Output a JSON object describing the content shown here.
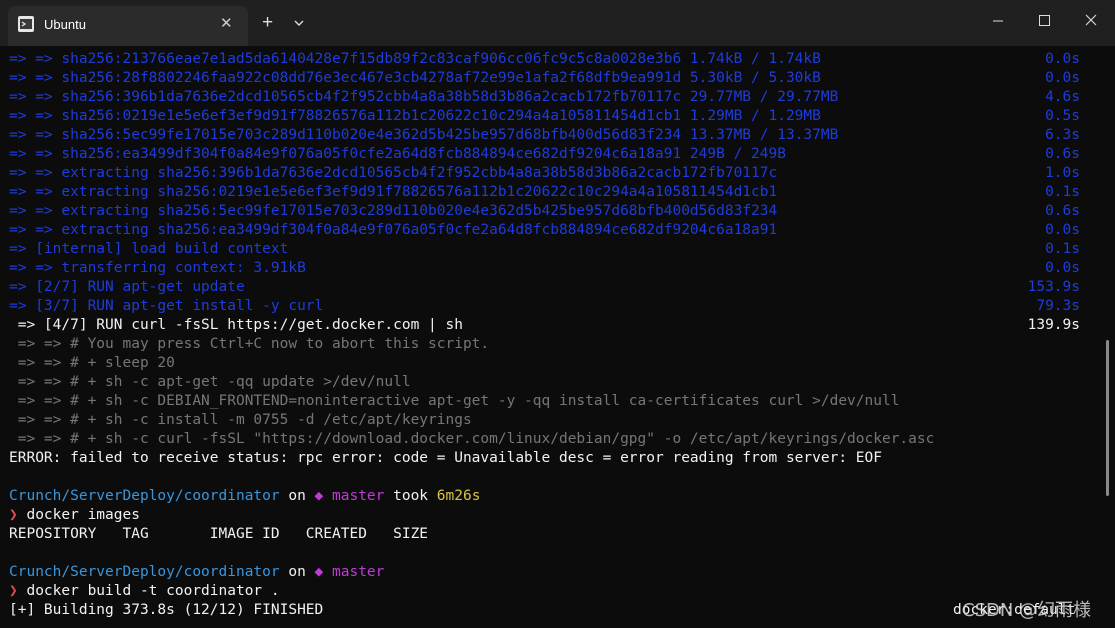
{
  "window": {
    "tab_title": "Ubuntu",
    "close_tab_glyph": "✕",
    "new_tab_glyph": "+",
    "icons": [
      "ubuntu-tab-icon",
      "close-icon",
      "plus-icon",
      "chevron-down-icon",
      "minimize-icon",
      "maximize-icon",
      "close-window-icon"
    ]
  },
  "terminal": {
    "build_steps": [
      {
        "text": "=> => sha256:213766eae7e1ad5da6140428e7f15db89f2c83caf906cc06fc9c5c8a0028e3b6 1.74kB / 1.74kB",
        "time": "0.0s"
      },
      {
        "text": "=> => sha256:28f8802246faa922c08dd76e3ec467e3cb4278af72e99e1afa2f68dfb9ea991d 5.30kB / 5.30kB",
        "time": "0.0s"
      },
      {
        "text": "=> => sha256:396b1da7636e2dcd10565cb4f2f952cbb4a8a38b58d3b86a2cacb172fb70117c 29.77MB / 29.77MB",
        "time": "4.6s"
      },
      {
        "text": "=> => sha256:0219e1e5e6ef3ef9d91f78826576a112b1c20622c10c294a4a105811454d1cb1 1.29MB / 1.29MB",
        "time": "0.5s"
      },
      {
        "text": "=> => sha256:5ec99fe17015e703c289d110b020e4e362d5b425be957d68bfb400d56d83f234 13.37MB / 13.37MB",
        "time": "6.3s"
      },
      {
        "text": "=> => sha256:ea3499df304f0a84e9f076a05f0cfe2a64d8fcb884894ce682df9204c6a18a91 249B / 249B",
        "time": "0.6s"
      },
      {
        "text": "=> => extracting sha256:396b1da7636e2dcd10565cb4f2f952cbb4a8a38b58d3b86a2cacb172fb70117c",
        "time": "1.0s"
      },
      {
        "text": "=> => extracting sha256:0219e1e5e6ef3ef9d91f78826576a112b1c20622c10c294a4a105811454d1cb1",
        "time": "0.1s"
      },
      {
        "text": "=> => extracting sha256:5ec99fe17015e703c289d110b020e4e362d5b425be957d68bfb400d56d83f234",
        "time": "0.6s"
      },
      {
        "text": "=> => extracting sha256:ea3499df304f0a84e9f076a05f0cfe2a64d8fcb884894ce682df9204c6a18a91",
        "time": "0.0s"
      },
      {
        "text": "=> [internal] load build context",
        "time": "0.1s"
      },
      {
        "text": "=> => transferring context: 3.91kB",
        "time": "0.0s"
      },
      {
        "text": "=> [2/7] RUN apt-get update",
        "time": "153.9s"
      },
      {
        "text": "=> [3/7] RUN apt-get install -y curl",
        "time": "79.3s"
      }
    ],
    "active_step": {
      "text": " => [4/7] RUN curl -fsSL https://get.docker.com | sh",
      "time": "139.9s"
    },
    "step_output": [
      " => => # You may press Ctrl+C now to abort this script.",
      " => => # + sleep 20",
      " => => # + sh -c apt-get -qq update >/dev/null",
      " => => # + sh -c DEBIAN_FRONTEND=noninteractive apt-get -y -qq install ca-certificates curl >/dev/null",
      " => => # + sh -c install -m 0755 -d /etc/apt/keyrings",
      " => => # + sh -c curl -fsSL \"https://download.docker.com/linux/debian/gpg\" -o /etc/apt/keyrings/docker.asc"
    ],
    "error_line": "ERROR: failed to receive status: rpc error: code = Unavailable desc = error reading from server: EOF",
    "prompt1": {
      "path": "Crunch/ServerDeploy/coordinator",
      "on": " on ",
      "branch_icon": "◆",
      "branch": " master",
      "took": " took ",
      "duration": "6m26s"
    },
    "prompt_symbol": "❯",
    "command1": " docker images",
    "table_header": "REPOSITORY   TAG       IMAGE ID   CREATED   SIZE",
    "prompt2": {
      "path": "Crunch/ServerDeploy/coordinator",
      "on": " on ",
      "branch_icon": "◆",
      "branch": " master"
    },
    "command2": " docker build -t coordinator .",
    "building_line": "[+] Building 373.8s (12/12) FINISHED",
    "watermark": "CSDN @幻雨様",
    "partial_text": "docker:default"
  },
  "colors": {
    "background": "#0c0c0c",
    "titlebar": "#202020",
    "blue": "#1e3cdc",
    "gray": "#767676",
    "cyan": "#3a96dd",
    "magenta": "#c23ad8",
    "yellow": "#d7c43e"
  }
}
